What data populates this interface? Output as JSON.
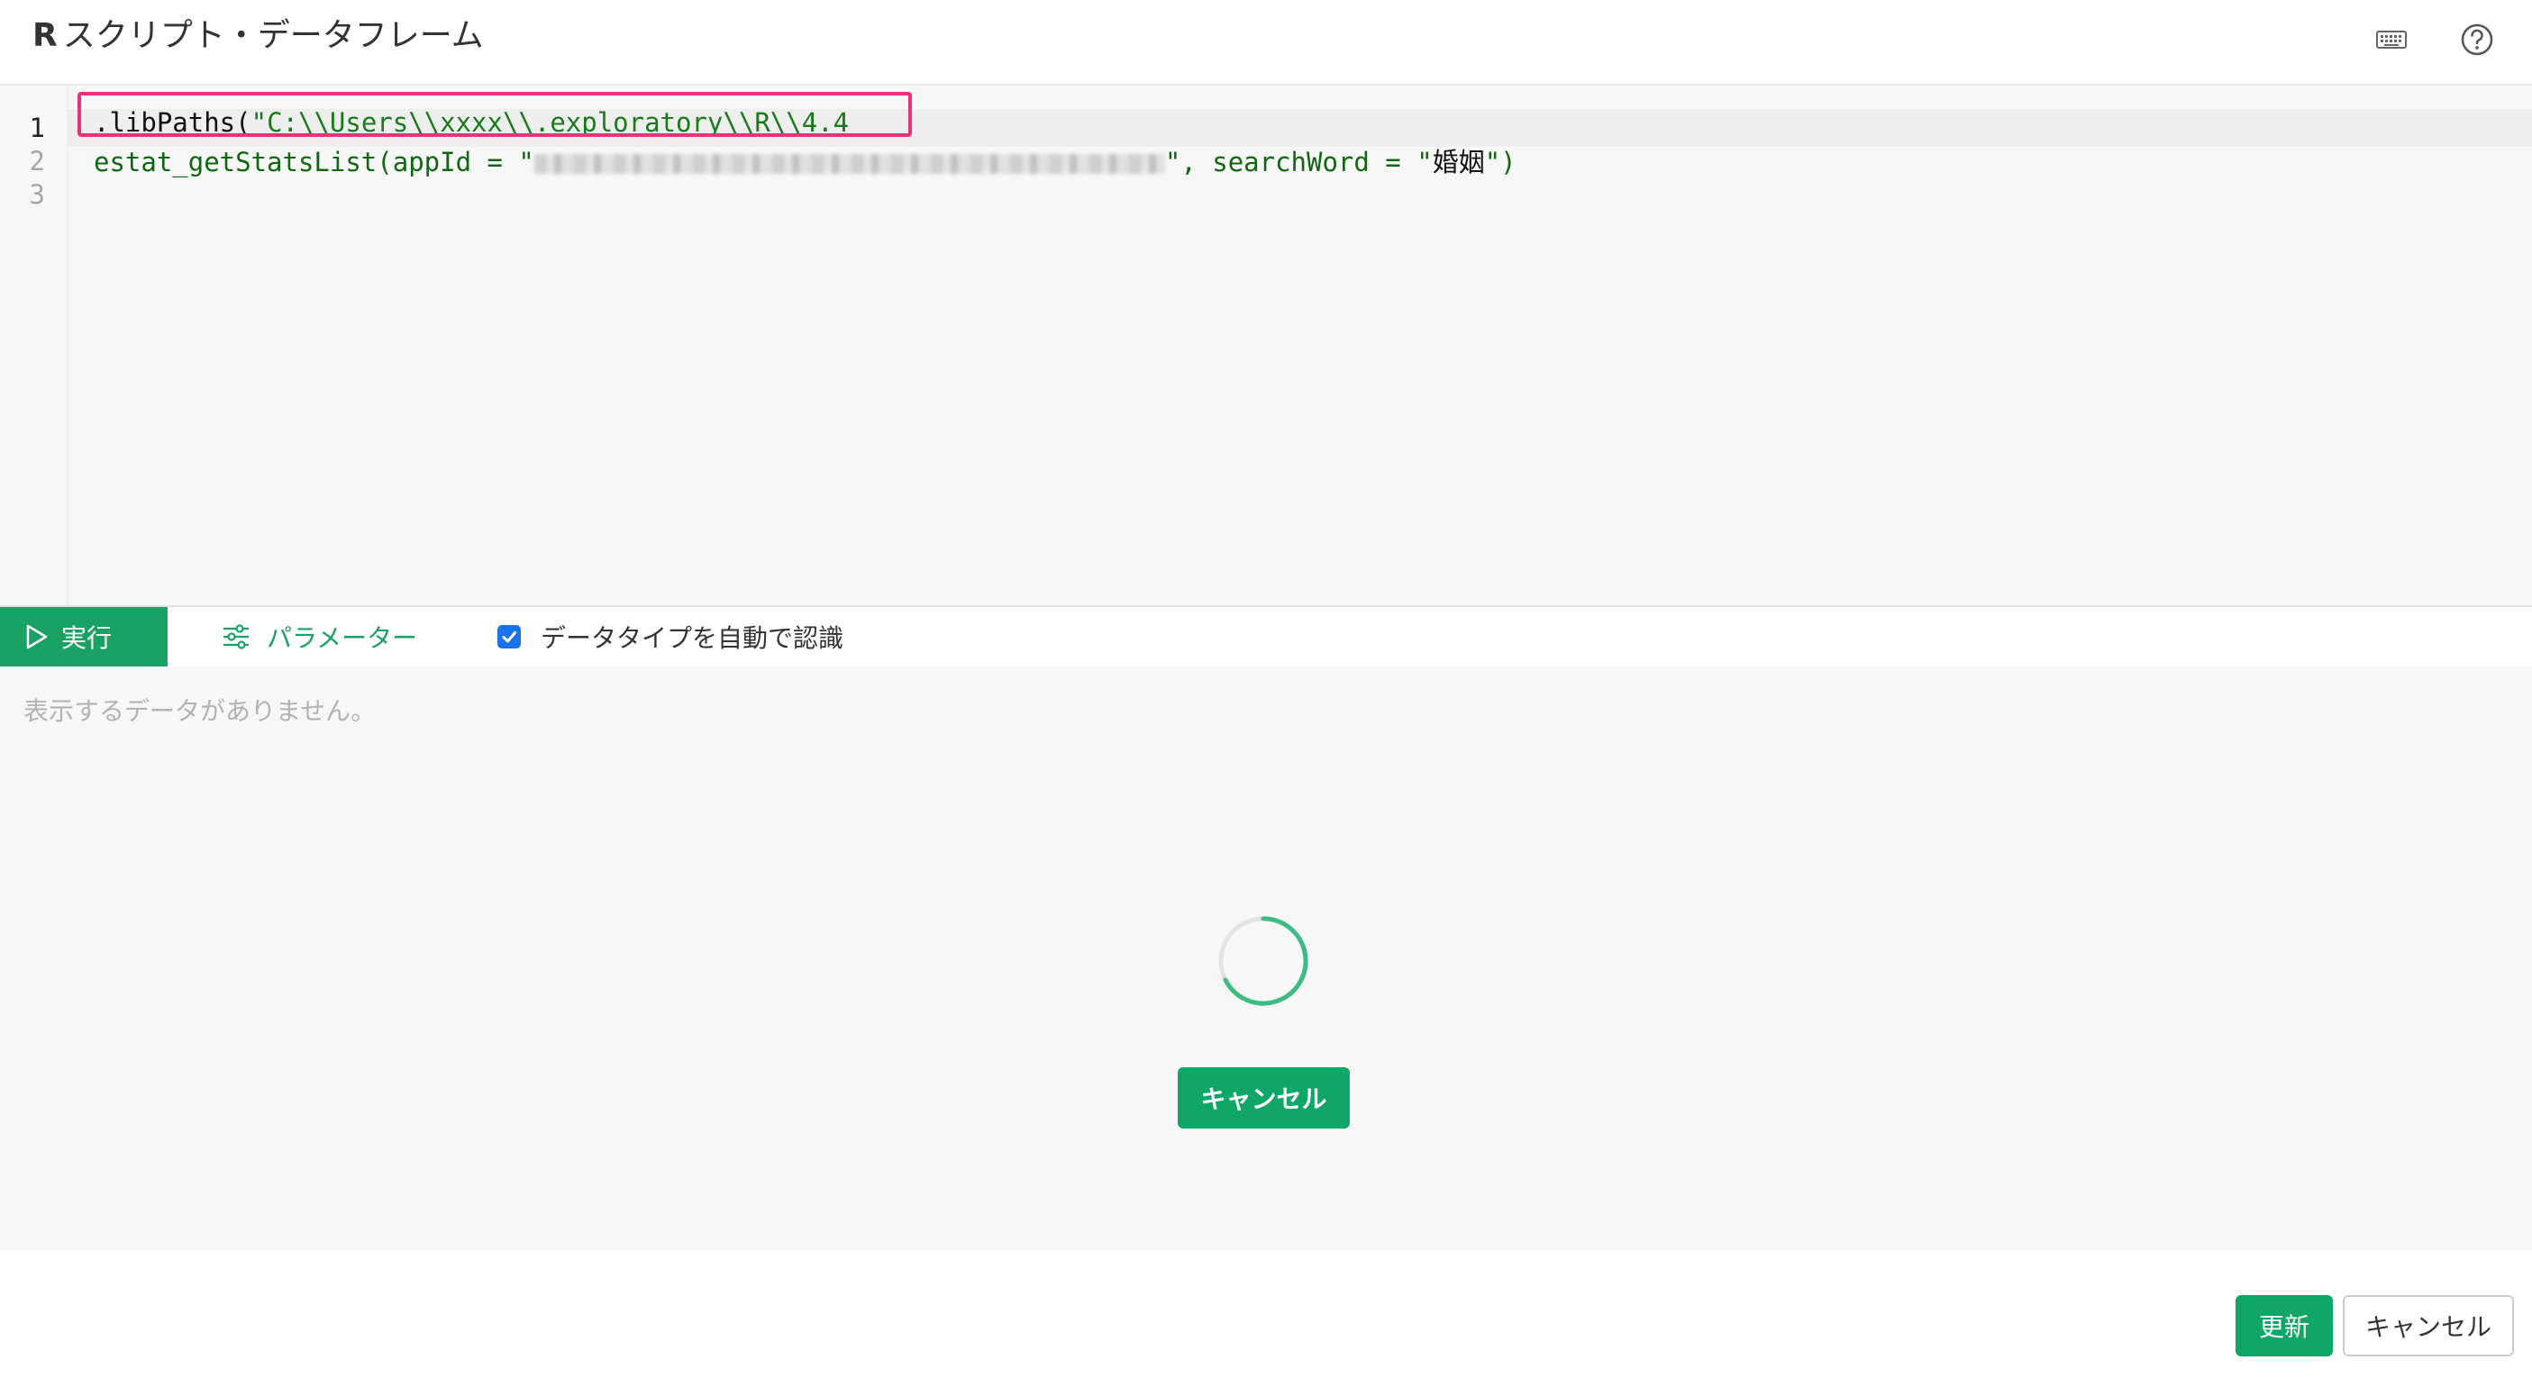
{
  "header": {
    "title_prefix": "R",
    "title": "スクリプト・データフレーム",
    "icons": [
      "keyboard-icon",
      "help-icon"
    ]
  },
  "editor": {
    "line_numbers": [
      "1",
      "2",
      "3"
    ],
    "lines": [
      {
        "fn": ".libPaths",
        "open": "(",
        "str": "\"C:\\\\Users\\\\xxxx\\\\.exploratory\\\\R\\\\4.4"
      },
      {
        "prefix": "estat_getStatsList(appId = \"",
        "suffix": "\", searchWord = \"",
        "jp": "婚姻",
        "end": "\")"
      },
      {}
    ]
  },
  "toolbar": {
    "run_label": "実行",
    "params_label": "パラメーター",
    "auto_type_label": "データタイプを自動で認識",
    "auto_type_checked": true
  },
  "output": {
    "empty_message": "表示するデータがありません。",
    "cancel_label": "キャンセル"
  },
  "footer": {
    "update_label": "更新",
    "cancel_label": "キャンセル"
  },
  "colors": {
    "accent": "#1aa164",
    "highlight_border": "#e8337a",
    "checkbox": "#1a73e8"
  }
}
